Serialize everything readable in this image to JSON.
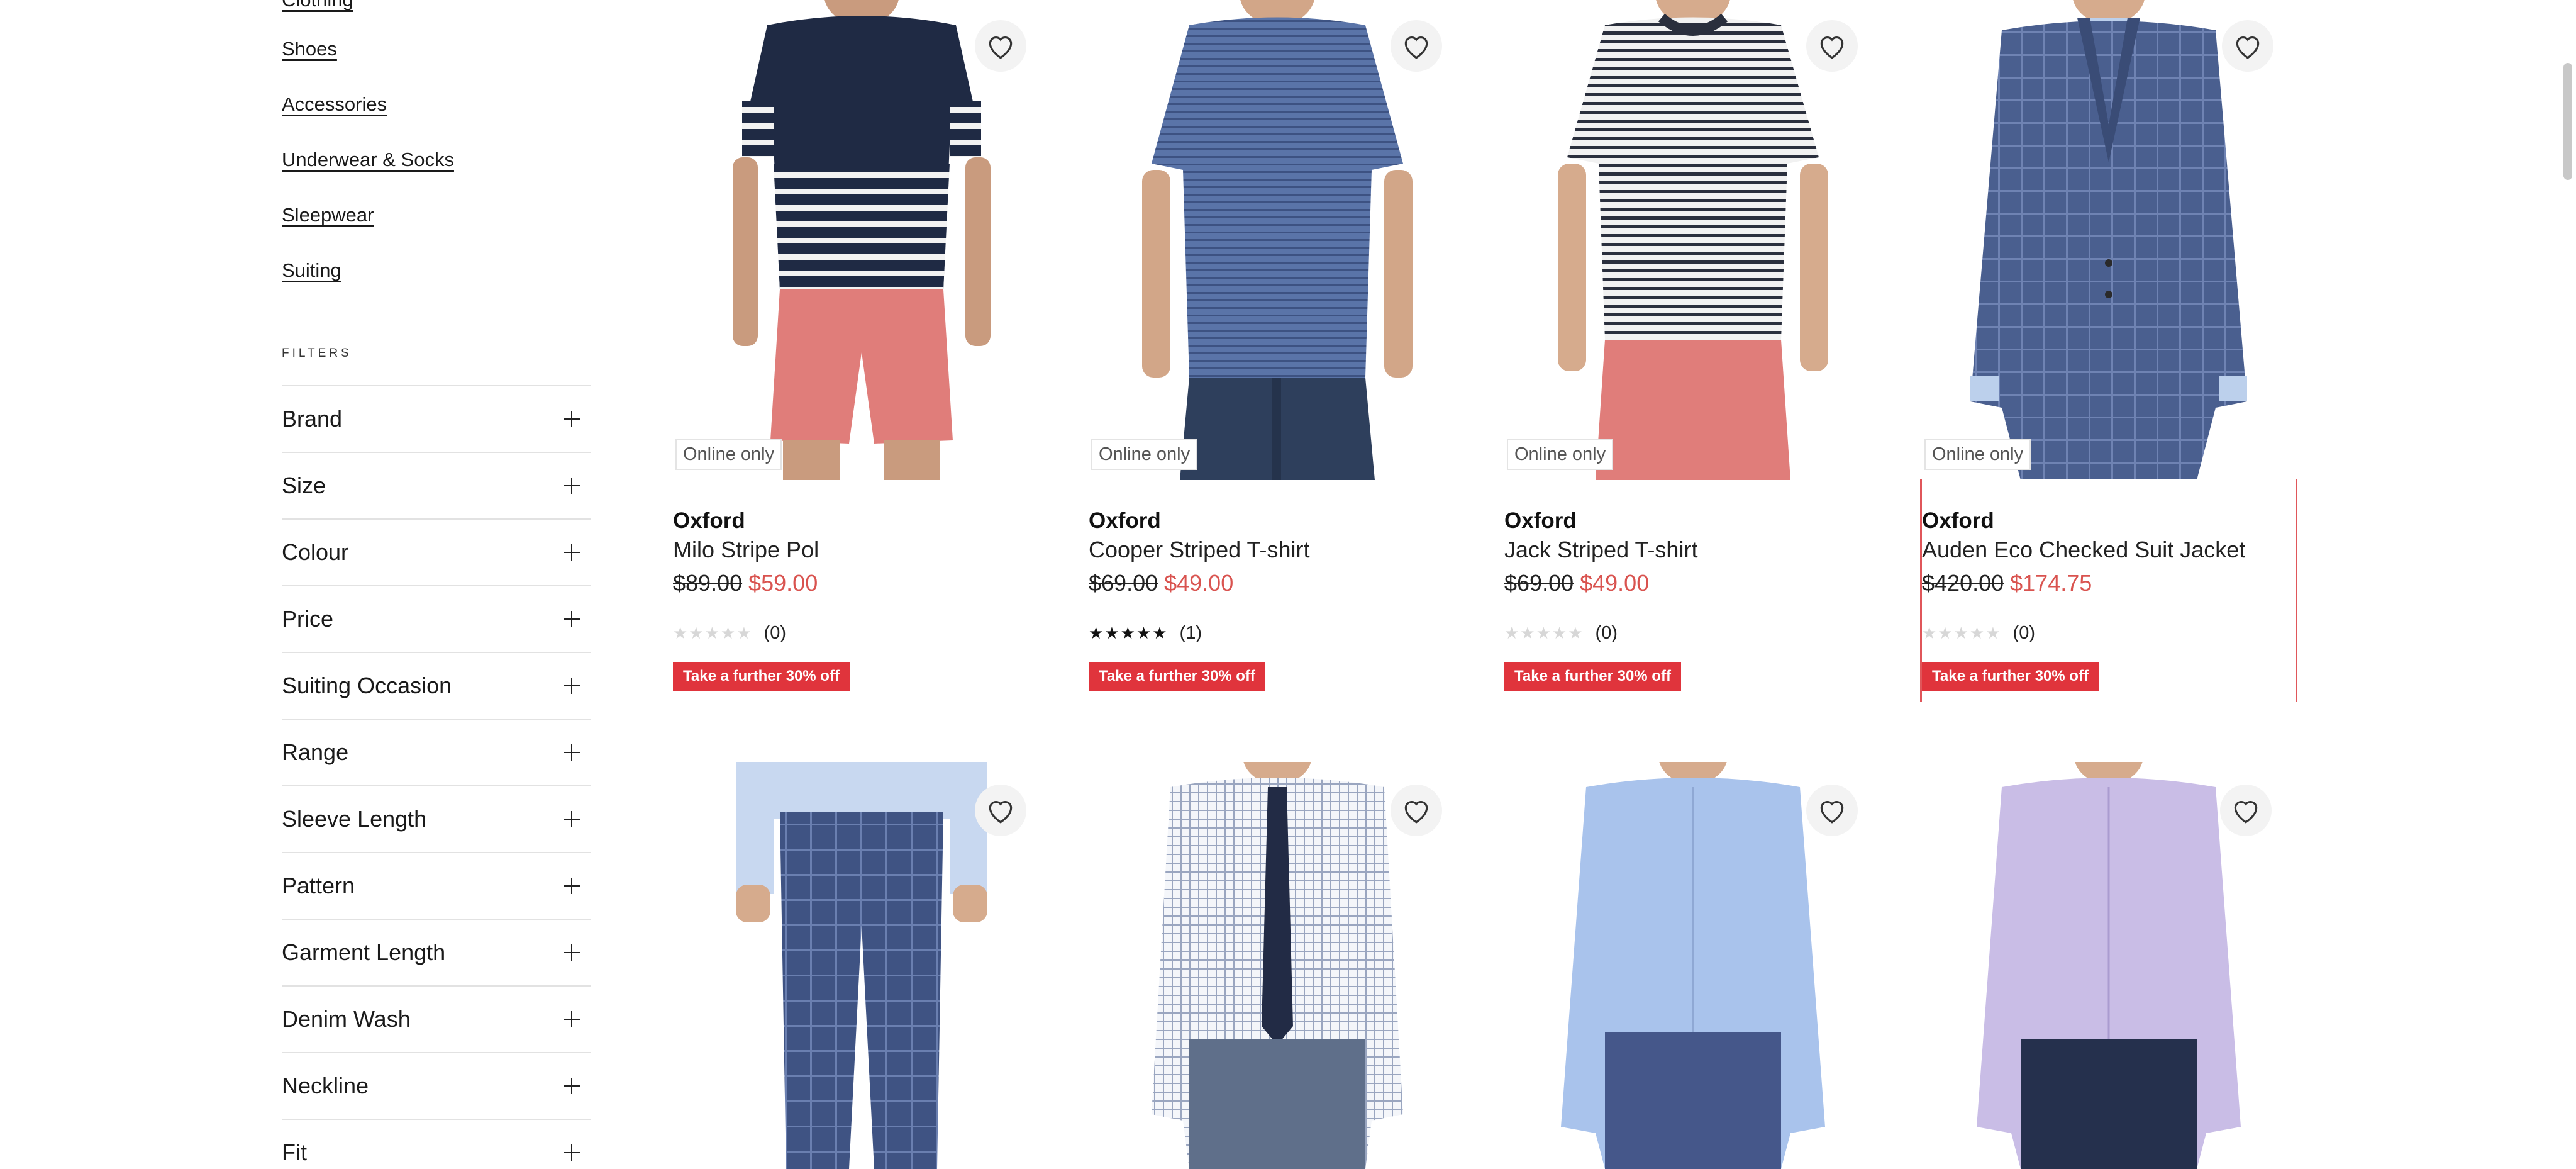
{
  "sidebar": {
    "categories": [
      {
        "label": "Clothing"
      },
      {
        "label": "Shoes"
      },
      {
        "label": "Accessories"
      },
      {
        "label": "Underwear & Socks"
      },
      {
        "label": "Sleepwear"
      },
      {
        "label": "Suiting"
      }
    ],
    "filters_heading": "FILTERS",
    "filters": [
      {
        "label": "Brand"
      },
      {
        "label": "Size"
      },
      {
        "label": "Colour"
      },
      {
        "label": "Price"
      },
      {
        "label": "Suiting Occasion"
      },
      {
        "label": "Range"
      },
      {
        "label": "Sleeve Length"
      },
      {
        "label": "Pattern"
      },
      {
        "label": "Garment Length"
      },
      {
        "label": "Denim Wash"
      },
      {
        "label": "Neckline"
      },
      {
        "label": "Fit"
      }
    ]
  },
  "products": [
    {
      "badge": "Online only",
      "brand": "Oxford",
      "name": "Milo Stripe Pol",
      "old_price": "$89.00",
      "new_price": "$59.00",
      "stars": "★★★★★",
      "rating_count": "(0)",
      "promo": "Take a further 30% off"
    },
    {
      "badge": "Online only",
      "brand": "Oxford",
      "name": "Cooper Striped T-shirt",
      "old_price": "$69.00",
      "new_price": "$49.00",
      "stars": "★★★★★",
      "rating_count": "(1)",
      "promo": "Take a further 30% off"
    },
    {
      "badge": "Online only",
      "brand": "Oxford",
      "name": "Jack Striped T-shirt",
      "old_price": "$69.00",
      "new_price": "$49.00",
      "stars": "★★★★★",
      "rating_count": "(0)",
      "promo": "Take a further 30% off"
    },
    {
      "badge": "Online only",
      "brand": "Oxford",
      "name": "Auden Eco Checked Suit Jacket",
      "old_price": "$420.00",
      "new_price": "$174.75",
      "stars": "★★★★★",
      "rating_count": "(0)",
      "promo": "Take a further 30% off"
    }
  ],
  "colors": {
    "sale_red": "#d9534f",
    "promo_bg": "#e0343c",
    "selection_border": "#e0565a"
  }
}
